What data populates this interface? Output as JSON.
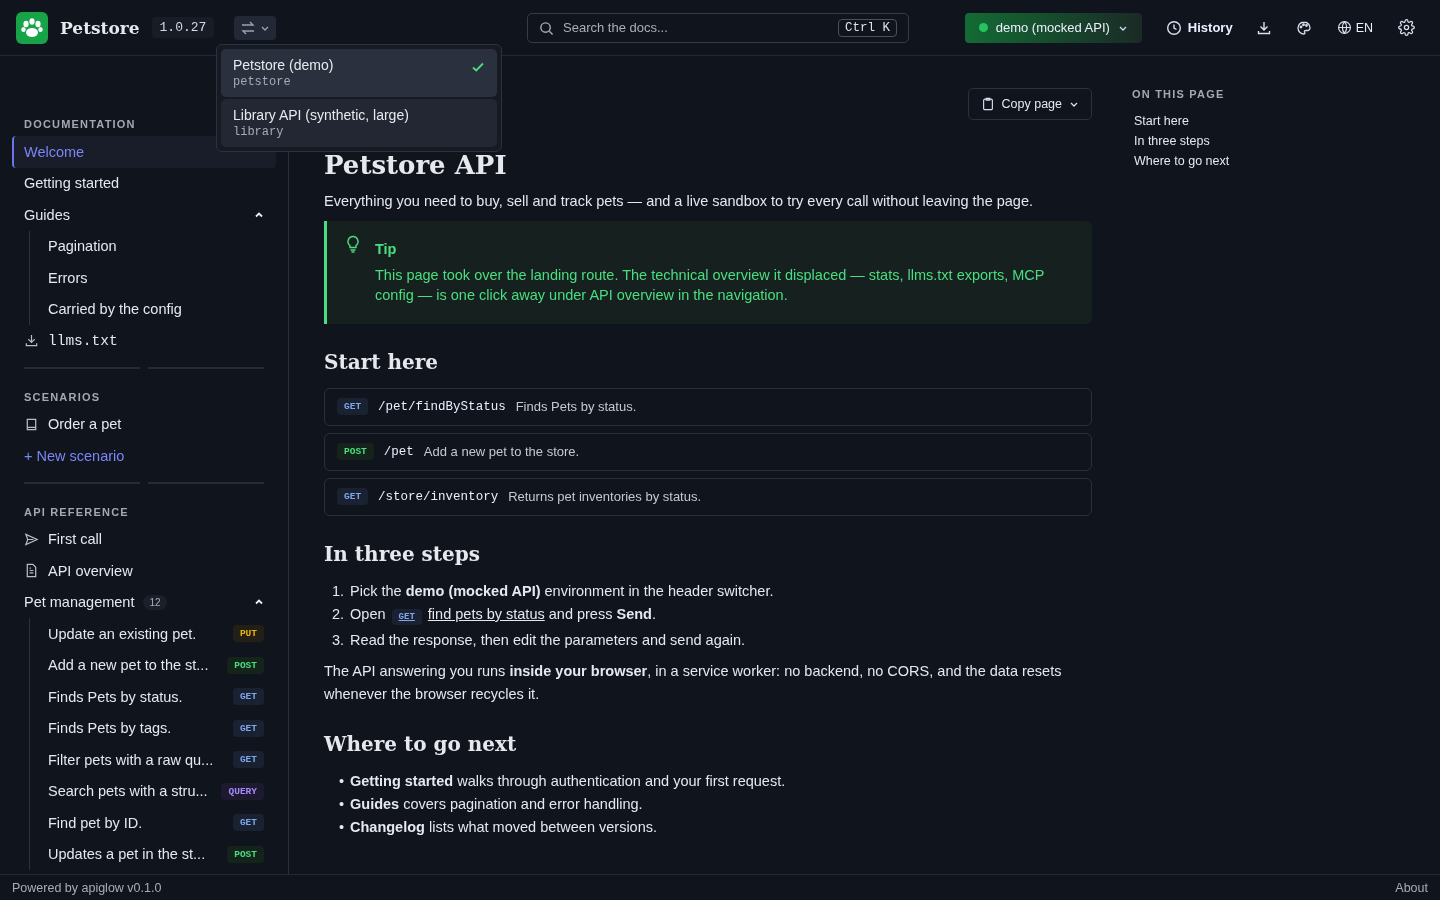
{
  "header": {
    "product": "Petstore",
    "version": "1.0.27",
    "search": {
      "placeholder": "Search the docs...",
      "shortcut": "Ctrl K"
    },
    "environment": {
      "label": "demo (mocked API)",
      "color": "#22c55e"
    },
    "history": "History",
    "language": "EN"
  },
  "api_switcher": {
    "expanded": true,
    "items": [
      {
        "name": "Petstore (demo)",
        "slug": "petstore",
        "selected": true
      },
      {
        "name": "Library API (synthetic, large)",
        "slug": "library",
        "selected": false
      }
    ]
  },
  "sidebar": {
    "sections": [
      {
        "title": "DOCUMENTATION",
        "items": [
          {
            "kind": "link",
            "label": "Welcome",
            "selected": true
          },
          {
            "kind": "link",
            "label": "Getting started",
            "selected": false
          },
          {
            "kind": "group",
            "label": "Guides",
            "expanded": true,
            "children": [
              {
                "label": "Pagination",
                "selected": false
              },
              {
                "label": "Errors",
                "selected": false
              },
              {
                "label": "Carried by the config",
                "selected": false
              }
            ]
          },
          {
            "kind": "download",
            "label": "llms.txt",
            "selected": false
          }
        ]
      },
      {
        "title": "SCENARIOS",
        "items": [
          {
            "kind": "scenario",
            "label": "Order a pet",
            "selected": false
          },
          {
            "kind": "action",
            "label": "+ New scenario",
            "selected": false
          }
        ]
      },
      {
        "title": "API REFERENCE",
        "items": [
          {
            "kind": "request",
            "label": "First call",
            "selected": false
          },
          {
            "kind": "document",
            "label": "API overview",
            "selected": false
          },
          {
            "kind": "group",
            "label": "Pet management",
            "count": "12",
            "expanded": true,
            "children": [
              {
                "label": "Update an existing pet.",
                "method": "PUT",
                "selected": false
              },
              {
                "label": "Add a new pet to the st...",
                "method": "POST",
                "selected": false
              },
              {
                "label": "Finds Pets by status.",
                "method": "GET",
                "selected": false
              },
              {
                "label": "Finds Pets by tags.",
                "method": "GET",
                "selected": false
              },
              {
                "label": "Filter pets with a raw qu...",
                "method": "GET",
                "selected": false
              },
              {
                "label": "Search pets with a stru...",
                "method": "QUERY",
                "selected": false
              },
              {
                "label": "Find pet by ID.",
                "method": "GET",
                "selected": false
              },
              {
                "label": "Updates a pet in the st...",
                "method": "POST",
                "selected": false
              }
            ]
          }
        ]
      }
    ]
  },
  "page": {
    "title": "Petstore API",
    "copy_button": "Copy page",
    "intro": "Everything you need to buy, sell and track pets — and a live sandbox to try every call without leaving the page.",
    "tip": {
      "title": "Tip",
      "text": "This page took over the landing route. The technical overview it displaced — stats, llms.txt exports, MCP config — is one click away under API overview in the navigation."
    },
    "sections": [
      {
        "kind": "endpoints",
        "heading": "Start here",
        "endpoints": [
          {
            "method": "GET",
            "path": "/pet/findByStatus",
            "summary": "Finds Pets by status."
          },
          {
            "method": "POST",
            "path": "/pet",
            "summary": "Add a new pet to the store."
          },
          {
            "method": "GET",
            "path": "/store/inventory",
            "summary": "Returns pet inventories by status."
          }
        ]
      },
      {
        "kind": "steps",
        "heading": "In three steps",
        "steps": [
          {
            "marker": "1.",
            "parts": [
              {
                "kind": "text",
                "text": "Pick the **demo (mocked API)** environment in the header switcher."
              }
            ]
          },
          {
            "marker": "2.",
            "parts": [
              {
                "kind": "text",
                "text": "Open"
              },
              {
                "kind": "method",
                "text": "GET"
              },
              {
                "kind": "link",
                "text": "find pets by status"
              },
              {
                "kind": "text",
                "text": "and press **Send**."
              }
            ]
          },
          {
            "marker": "3.",
            "parts": [
              {
                "kind": "text",
                "text": "Read the response, then edit the parameters and send again."
              }
            ]
          }
        ],
        "paragraph": "The API answering you runs **inside your browser**, in a service worker: no backend, no CORS, and the data resets whenever the browser recycles it."
      },
      {
        "kind": "bullets",
        "heading": "Where to go next",
        "bullets": [
          {
            "marker": "•",
            "text": "**Getting started** walks through authentication and your first request."
          },
          {
            "marker": "•",
            "text": "**Guides** covers pagination and error handling."
          },
          {
            "marker": "•",
            "text": "**Changelog** lists what moved between versions."
          }
        ]
      }
    ]
  },
  "toc": {
    "title": "ON THIS PAGE",
    "items": [
      "Start here",
      "In three steps",
      "Where to go next"
    ]
  },
  "footer": {
    "powered_by": "Powered by apiglow v0.1.0",
    "about": "About"
  }
}
